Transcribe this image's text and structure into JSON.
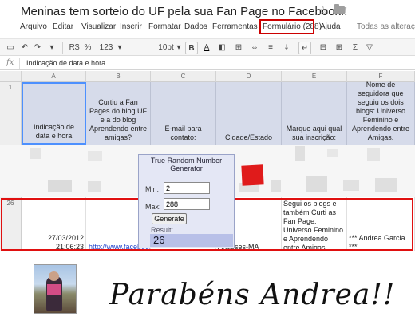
{
  "window": {
    "title": "Meninas tem sorteio do UF pela sua Fan Page no Facebook!!"
  },
  "menu": {
    "items": [
      "Arquivo",
      "Editar",
      "Visualizar",
      "Inserir",
      "Formatar",
      "Dados",
      "Ferramentas",
      "Formulário (288)",
      "Ajuda"
    ],
    "all_changes": "Todas as alteraçõ"
  },
  "toolbar": {
    "currency": "R$",
    "percent": "%",
    "number_format": "123",
    "font_size": "10pt",
    "bold": "B",
    "text_color": "A",
    "sum": "Σ"
  },
  "formula_bar": {
    "fx": "fx",
    "content": "Indicação de data e hora"
  },
  "columns": [
    "A",
    "B",
    "C",
    "D",
    "E",
    "F"
  ],
  "header_row": {
    "number": "1",
    "cells": [
      "Indicação de data e hora",
      "Curtiu a Fan Pages do blog UF e a do blog Aprendendo entre amigas?",
      "E-mail para contato:",
      "Cidade/Estado",
      "Marque aqui qual sua inscrição:",
      "Nome de seguidora que seguiu os dois blogs: Universo Feminino e Aprendendo entre Amigas."
    ]
  },
  "data_row": {
    "number": "26",
    "date": "27/03/2012",
    "time": "21:06:23",
    "link": "http://www.facebook",
    "city": "Araioses-MA",
    "inscription": "Segui os blogs e também Curti as Fan Page: Universo Feminino e Aprendendo entre Amigas.",
    "name": "*** Andrea Garcia ***"
  },
  "rng": {
    "title": "True Random Number Generator",
    "min_label": "Min:",
    "min_value": "2",
    "max_label": "Max:",
    "max_value": "288",
    "button": "Generate",
    "result_label": "Result:",
    "result": "26"
  },
  "caption": "Parabéns Andrea!!",
  "colors": {
    "highlight": "#e01010",
    "header_bg": "#d6dbea",
    "rng_bg": "#e4e7f5",
    "result_bg": "#b8c0e8"
  }
}
